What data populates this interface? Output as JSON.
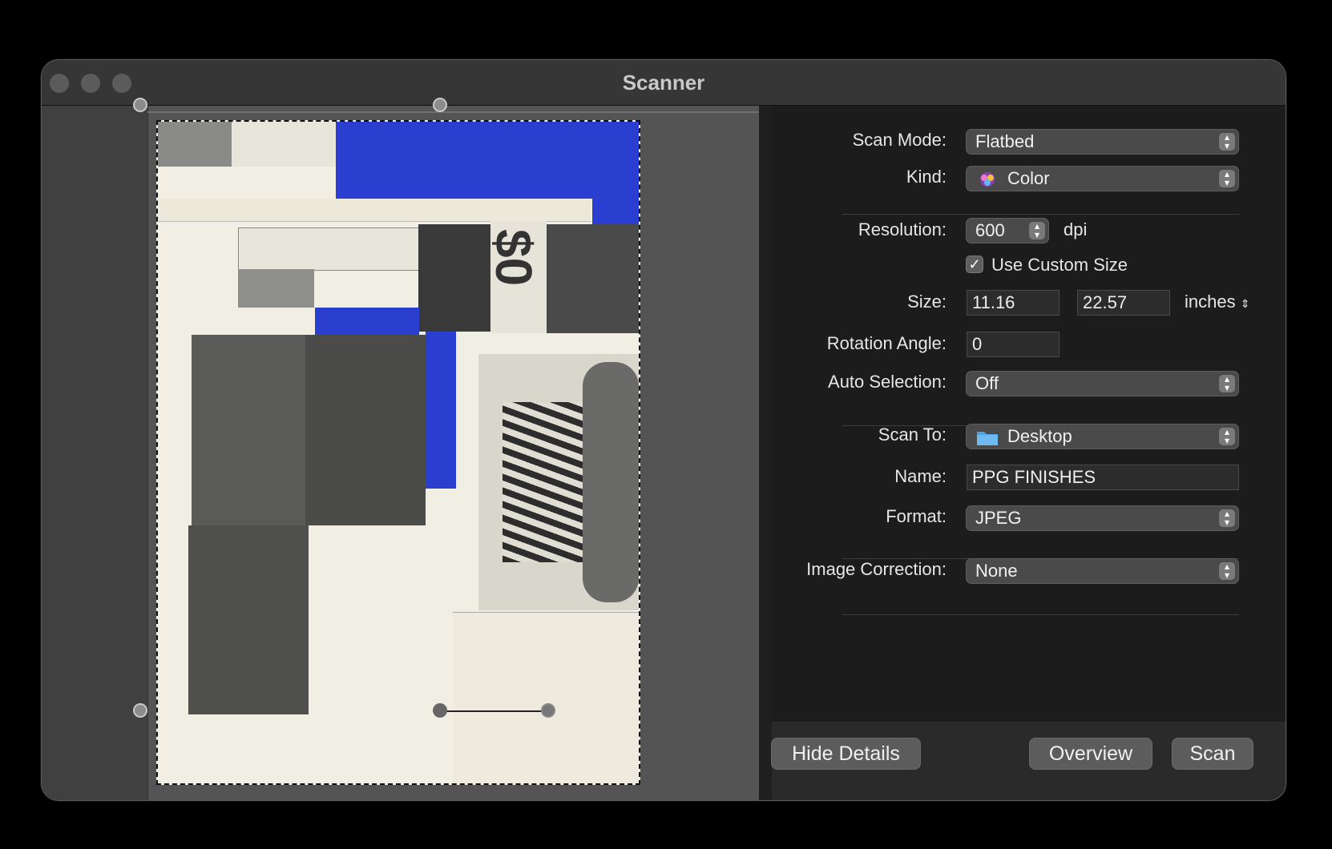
{
  "window": {
    "title": "Scanner"
  },
  "details": {
    "scan_mode": {
      "label": "Scan Mode:",
      "value": "Flatbed"
    },
    "kind": {
      "label": "Kind:",
      "value": "Color",
      "icon": "color-icon"
    },
    "resolution": {
      "label": "Resolution:",
      "value": "600",
      "unit": "dpi"
    },
    "custom_size": {
      "label": "Use Custom Size",
      "checked": true
    },
    "size": {
      "label": "Size:",
      "width": "11.16",
      "height": "22.57",
      "unit": "inches"
    },
    "rotation": {
      "label": "Rotation Angle:",
      "value": "0"
    },
    "auto_selection": {
      "label": "Auto Selection:",
      "value": "Off"
    },
    "scan_to": {
      "label": "Scan To:",
      "value": "Desktop",
      "icon": "folder-icon"
    },
    "name": {
      "label": "Name:",
      "value": "PPG FINISHES"
    },
    "format": {
      "label": "Format:",
      "value": "JPEG"
    },
    "image_correction": {
      "label": "Image Correction:",
      "value": "None"
    }
  },
  "buttons": {
    "hide_details": "Hide Details",
    "overview": "Overview",
    "scan": "Scan"
  },
  "colors": {
    "window_bg": "#1f1f1f",
    "titlebar": "#363636",
    "preview_bg": "#545454",
    "accent_blue": "#2a3fcf"
  }
}
